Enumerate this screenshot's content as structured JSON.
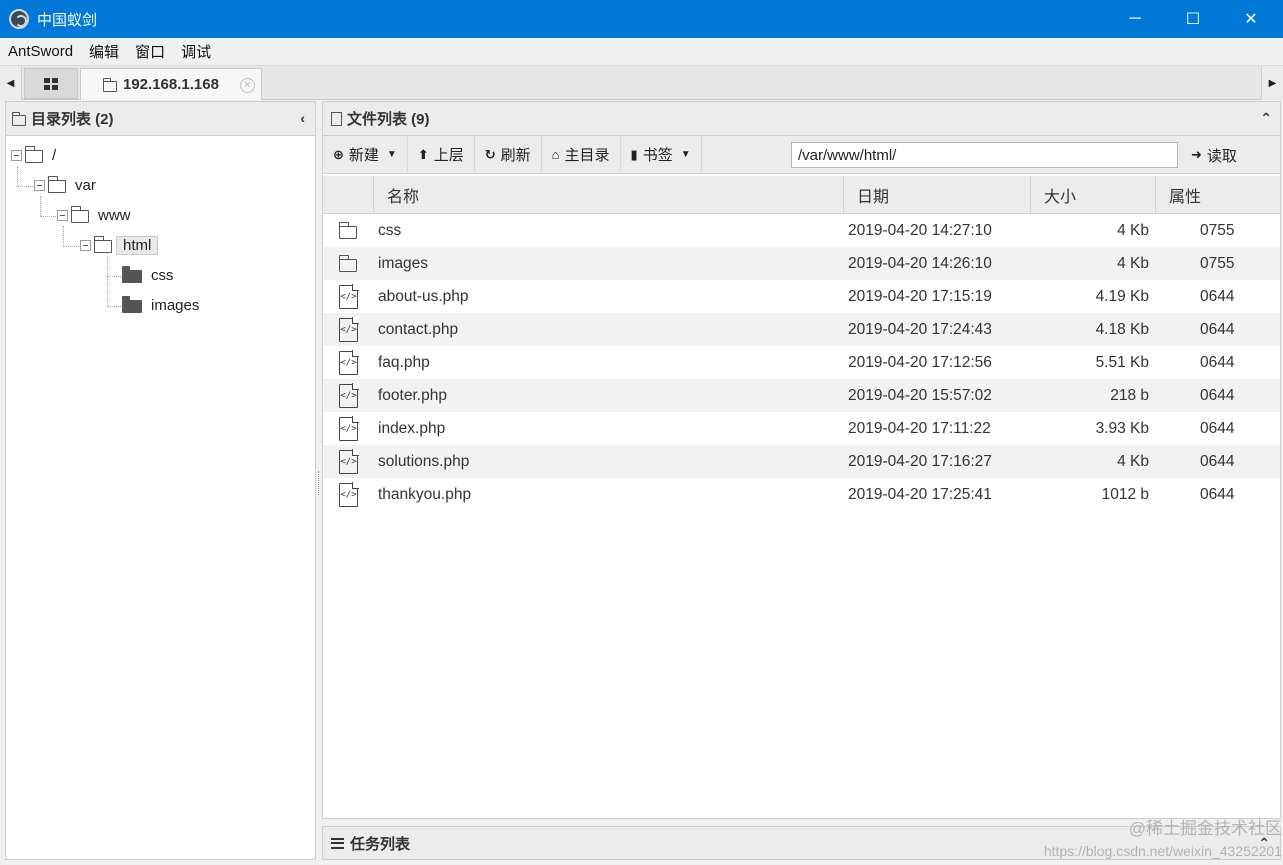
{
  "window": {
    "title": "中国蚁剑",
    "controls": {
      "minimize": "─",
      "maximize": "☐",
      "close": "✕"
    }
  },
  "menu": [
    "AntSword",
    "编辑",
    "窗口",
    "调试"
  ],
  "tabs": {
    "host_label": "192.168.1.168",
    "close_glyph": "✕",
    "left_arrow": "◀",
    "right_arrow": "▶"
  },
  "directory_panel": {
    "title": "目录列表 (2)",
    "collapse_glyph": "‹",
    "tree": [
      {
        "label": "/",
        "type": "folder-open",
        "selected": false
      },
      {
        "label": "var",
        "type": "folder-open",
        "selected": false
      },
      {
        "label": "www",
        "type": "folder-open",
        "selected": false
      },
      {
        "label": "html",
        "type": "folder-open",
        "selected": true
      },
      {
        "label": "css",
        "type": "folder-closed",
        "selected": false
      },
      {
        "label": "images",
        "type": "folder-closed",
        "selected": false
      }
    ]
  },
  "file_panel": {
    "title": "文件列表 (9)",
    "collapse_glyph": "⌃",
    "toolbar": {
      "new_label": "新建",
      "up_label": "上层",
      "refresh_label": "刷新",
      "home_label": "主目录",
      "bookmark_label": "书签",
      "path_value": "/var/www/html/",
      "read_label": "读取",
      "new_icon": "⊕",
      "up_icon": "⬆",
      "refresh_icon": "↻",
      "home_icon": "⌂",
      "bookmark_icon": "▮",
      "read_icon": "➜",
      "caret": "▼"
    },
    "columns": {
      "name": "名称",
      "date": "日期",
      "size": "大小",
      "perm": "属性"
    },
    "files": [
      {
        "icon": "folder-icon",
        "name": "css",
        "date": "2019-04-20 14:27:10",
        "size": "4 Kb",
        "perm": "0755"
      },
      {
        "icon": "folder-icon",
        "name": "images",
        "date": "2019-04-20 14:26:10",
        "size": "4 Kb",
        "perm": "0755"
      },
      {
        "icon": "php-file-icon",
        "name": "about-us.php",
        "date": "2019-04-20 17:15:19",
        "size": "4.19 Kb",
        "perm": "0644"
      },
      {
        "icon": "php-file-icon",
        "name": "contact.php",
        "date": "2019-04-20 17:24:43",
        "size": "4.18 Kb",
        "perm": "0644"
      },
      {
        "icon": "php-file-icon",
        "name": "faq.php",
        "date": "2019-04-20 17:12:56",
        "size": "5.51 Kb",
        "perm": "0644"
      },
      {
        "icon": "php-file-icon",
        "name": "footer.php",
        "date": "2019-04-20 15:57:02",
        "size": "218 b",
        "perm": "0644"
      },
      {
        "icon": "php-file-icon",
        "name": "index.php",
        "date": "2019-04-20 17:11:22",
        "size": "3.93 Kb",
        "perm": "0644"
      },
      {
        "icon": "php-file-icon",
        "name": "solutions.php",
        "date": "2019-04-20 17:16:27",
        "size": "4 Kb",
        "perm": "0644"
      },
      {
        "icon": "php-file-icon",
        "name": "thankyou.php",
        "date": "2019-04-20 17:25:41",
        "size": "1012 b",
        "perm": "0644"
      }
    ],
    "php_glyph": "</>"
  },
  "task_panel": {
    "title": "任务列表",
    "expand_glyph": "⌃"
  },
  "watermark": {
    "line1": "@稀土掘金技术社区",
    "line2": "https://blog.csdn.net/weixin_43252201"
  },
  "colors": {
    "titlebar": "#0078d7",
    "panel_head": "#ececec",
    "alt_row": "#f2f2f2"
  }
}
